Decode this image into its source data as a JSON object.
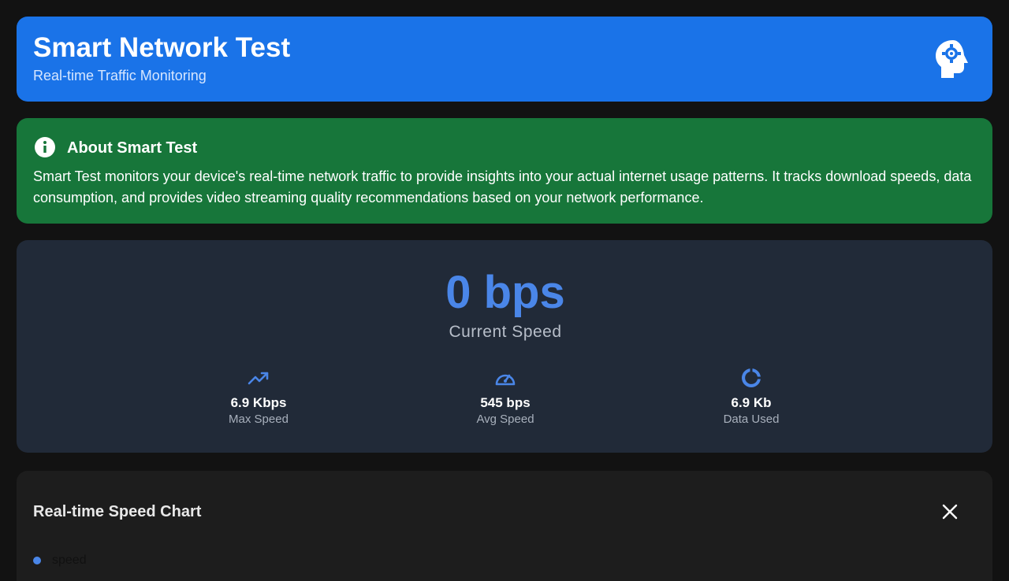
{
  "header": {
    "title": "Smart Network Test",
    "subtitle": "Real-time Traffic Monitoring",
    "icon": "psychology-gear-icon"
  },
  "about": {
    "icon": "info-icon",
    "title": "About Smart Test",
    "text": "Smart Test monitors your device's real-time network traffic to provide insights into your actual internet usage patterns. It tracks download speeds, data consumption, and provides video streaming quality recommendations based on your network performance."
  },
  "speed": {
    "current_value": "0 bps",
    "current_label": "Current Speed",
    "stats": [
      {
        "icon": "trending-up-icon",
        "value": "6.9 Kbps",
        "label": "Max Speed"
      },
      {
        "icon": "speedometer-icon",
        "value": "545 bps",
        "label": "Avg Speed"
      },
      {
        "icon": "donut-chart-icon",
        "value": "6.9 Kb",
        "label": "Data Used"
      }
    ]
  },
  "chart": {
    "title": "Real-time Speed Chart",
    "legend_label": "speed",
    "legend_color": "#4a86e8"
  },
  "colors": {
    "header_bg": "#1a73e8",
    "about_bg": "#17763a",
    "card_bg": "#212a38",
    "accent": "#4a86e8",
    "page_bg": "#121212"
  }
}
